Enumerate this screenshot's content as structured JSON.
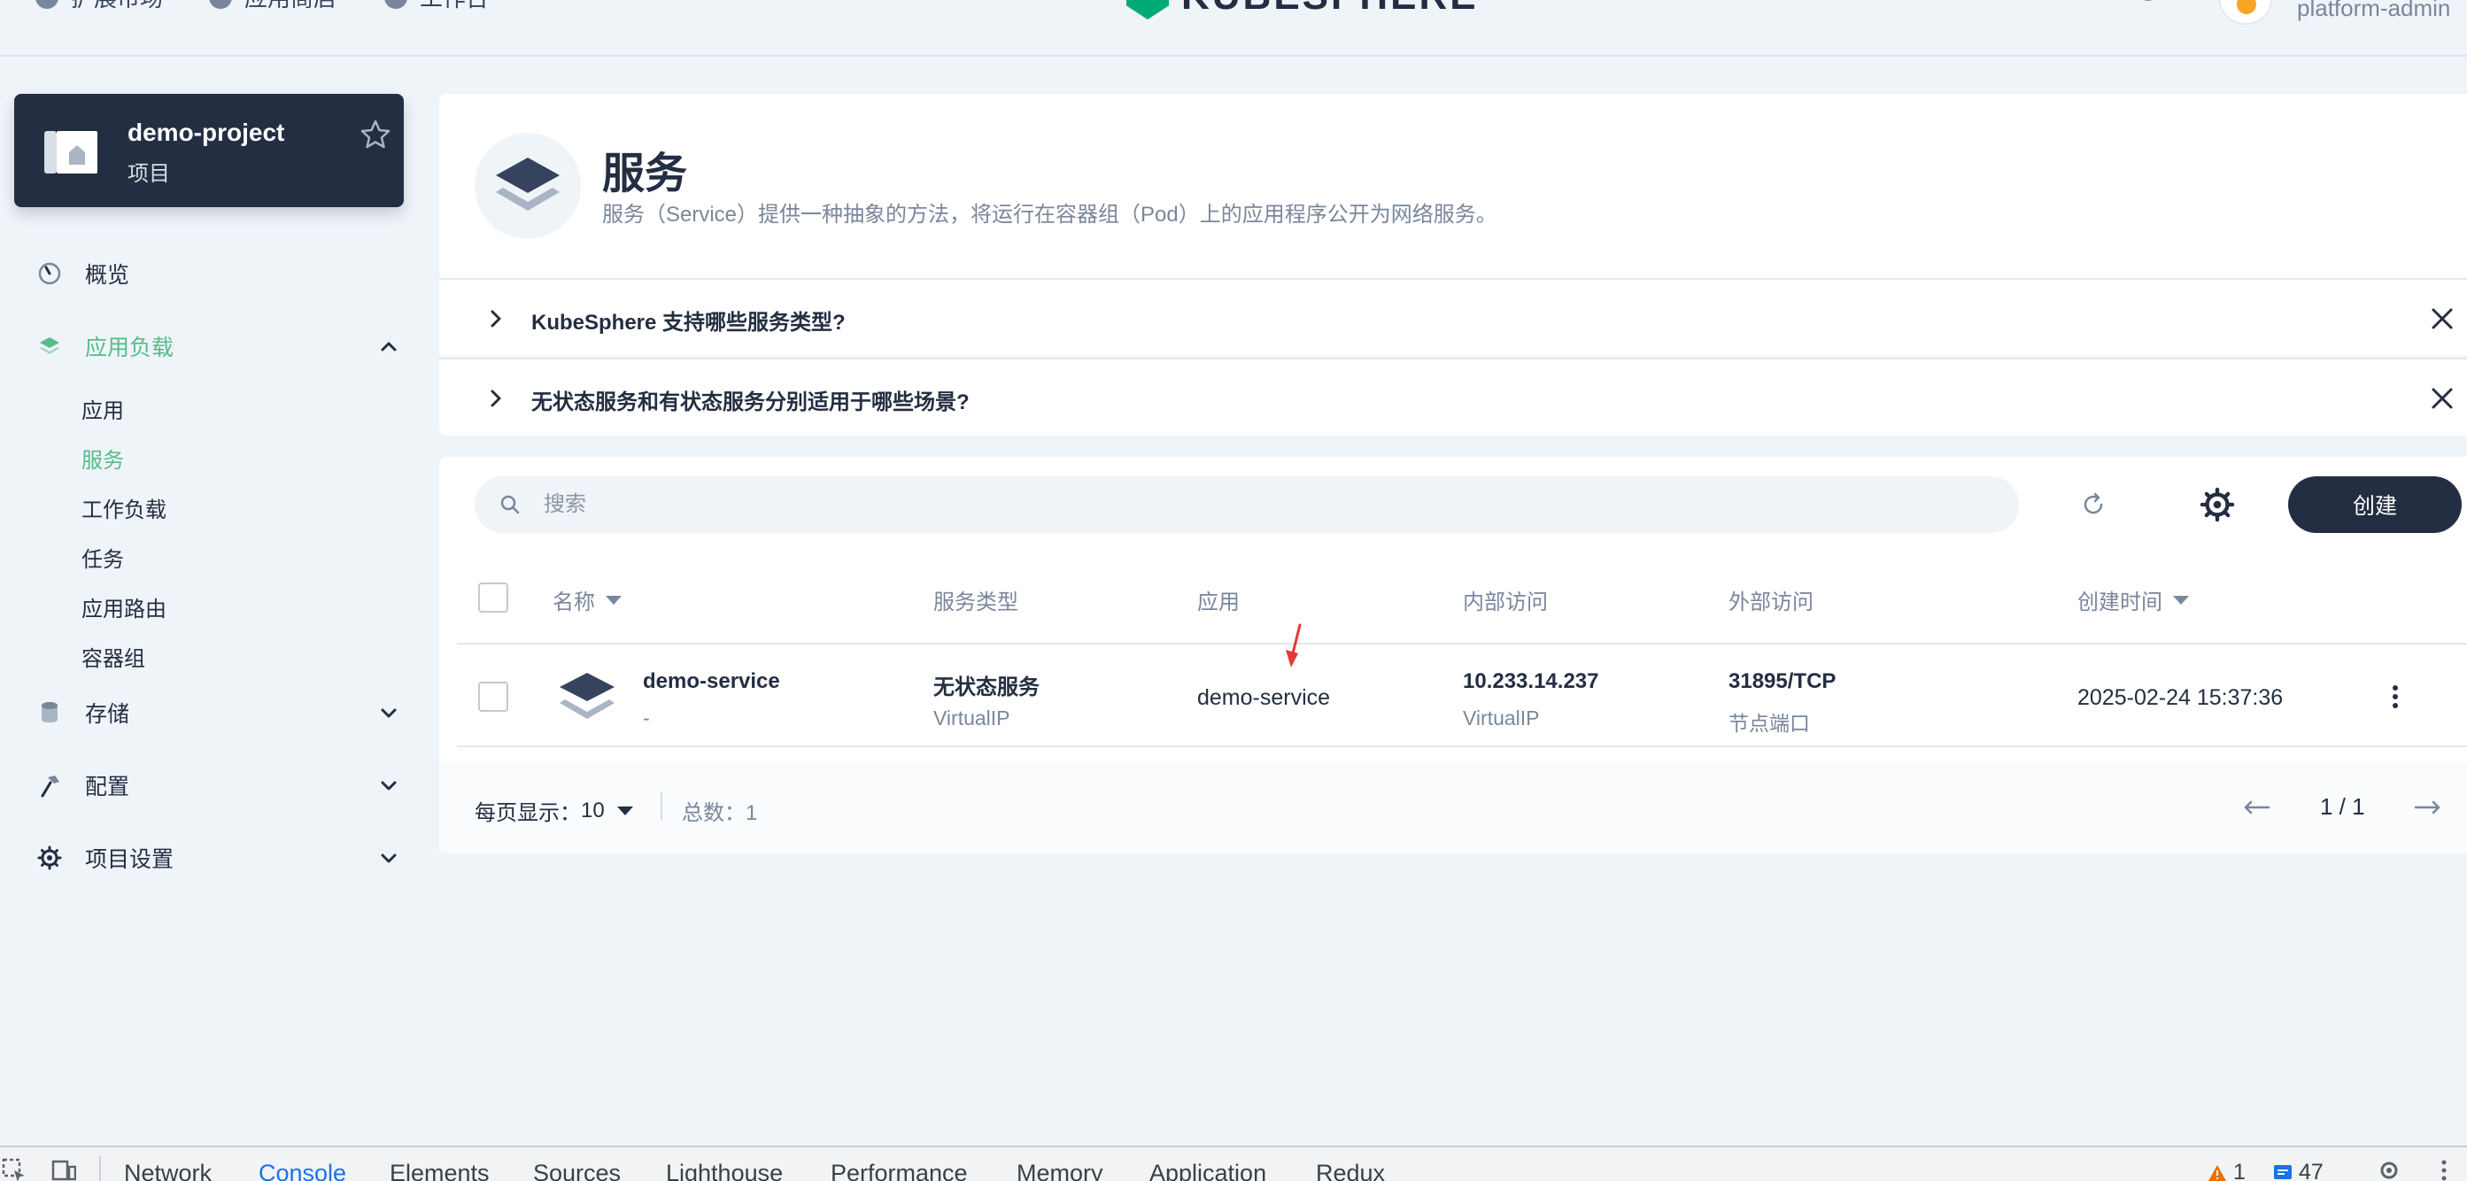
{
  "topbar": {
    "nav": [
      "扩展市场",
      "应用商店",
      "工作台"
    ],
    "logo_text": "KUBESPHERE",
    "username": "platform-admin"
  },
  "project": {
    "name": "demo-project",
    "type": "项目"
  },
  "sidebar": {
    "items": [
      {
        "label": "概览",
        "icon": "dashboard-icon"
      },
      {
        "label": "应用负载",
        "icon": "layers-icon",
        "expanded": true
      },
      {
        "label": "存储",
        "icon": "database-icon"
      },
      {
        "label": "配置",
        "icon": "hammer-icon"
      },
      {
        "label": "项目设置",
        "icon": "gear-icon"
      }
    ],
    "subitems": [
      "应用",
      "服务",
      "工作负载",
      "任务",
      "应用路由",
      "容器组"
    ],
    "active_subitem": "服务"
  },
  "header": {
    "title": "服务",
    "description": "服务（Service）提供一种抽象的方法，将运行在容器组（Pod）上的应用程序公开为网络服务。"
  },
  "faq": [
    "KubeSphere 支持哪些服务类型?",
    "无状态服务和有状态服务分别适用于哪些场景?"
  ],
  "toolbar": {
    "search_placeholder": "搜索",
    "create_label": "创建"
  },
  "table": {
    "columns": [
      "名称",
      "服务类型",
      "应用",
      "内部访问",
      "外部访问",
      "创建时间"
    ],
    "rows": [
      {
        "name": "demo-service",
        "name_sub": "-",
        "type": "无状态服务",
        "type_sub": "VirtualIP",
        "app": "demo-service",
        "internal": "10.233.14.237",
        "internal_sub": "VirtualIP",
        "external": "31895/TCP",
        "external_sub": "节点端口",
        "created": "2025-02-24 15:37:36"
      }
    ]
  },
  "pagination": {
    "per_page_label": "每页显示：",
    "per_page_value": "10",
    "total_label": "总数：1",
    "page": "1 / 1"
  },
  "devtools": {
    "tabs": [
      "Network",
      "Console",
      "Elements",
      "Sources",
      "Lighthouse",
      "Performance",
      "Memory",
      "Application",
      "Redux"
    ],
    "active_tab": "Console",
    "warnings": "1",
    "messages": "47"
  },
  "colors": {
    "accent_green": "#55bc8a",
    "dark": "#242e42",
    "muted": "#79879c",
    "background": "#eff4f9",
    "annotation_red": "#e53935"
  }
}
